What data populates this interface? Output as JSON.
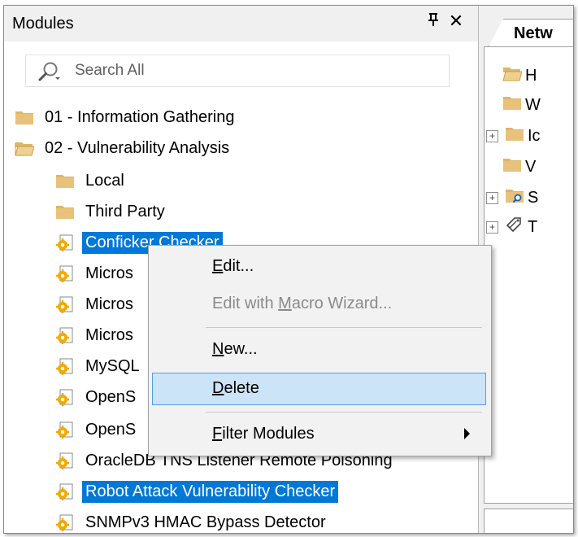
{
  "panel": {
    "title": "Modules",
    "pin_glyph": "`a",
    "close_glyph": "✕",
    "search_placeholder": "Search All"
  },
  "tree": {
    "items": [
      {
        "label": "01 - Information Gathering",
        "icon": "folder-icon"
      },
      {
        "label": "02 - Vulnerability Analysis",
        "icon": "folder-open-icon"
      },
      {
        "label": "Local",
        "icon": "folder-icon"
      },
      {
        "label": "Third Party",
        "icon": "folder-icon"
      },
      {
        "label": "Conficker Checker",
        "icon": "module-gear-icon",
        "selected": true
      },
      {
        "label": "Micros",
        "icon": "module-gear-icon"
      },
      {
        "label": "Micros",
        "icon": "module-gear-icon"
      },
      {
        "label": "Micros",
        "icon": "module-gear-icon"
      },
      {
        "label": "MySQL",
        "icon": "module-gear-icon"
      },
      {
        "label": "OpenS",
        "icon": "module-gear-icon"
      },
      {
        "label": "OpenS",
        "icon": "module-gear-icon"
      },
      {
        "label": "OracleDB TNS Listener Remote Poisoning",
        "icon": "module-gear-icon"
      },
      {
        "label": "Robot Attack Vulnerability Checker",
        "icon": "module-gear-icon",
        "selected": true
      },
      {
        "label": "SNMPv3 HMAC Bypass Detector",
        "icon": "module-gear-icon"
      }
    ]
  },
  "right_pane": {
    "tab_label": "Netw",
    "rows": [
      "H",
      "W",
      "Ic",
      "V",
      "S",
      "T"
    ]
  },
  "context_menu": {
    "edit_pre": "",
    "edit_u": "E",
    "edit_post": "dit...",
    "macro_pre": "Edit with ",
    "macro_u": "M",
    "macro_post": "acro Wizard...",
    "new_pre": "",
    "new_u": "N",
    "new_post": "ew...",
    "delete_pre": "",
    "delete_u": "D",
    "delete_post": "elete",
    "filter_pre": "",
    "filter_u": "F",
    "filter_post": "ilter Modules"
  },
  "colors": {
    "selection": "#0078d7",
    "menu_highlight": "#cce4f7",
    "menu_highlight_border": "#569de5",
    "folder": "#dcb66b"
  }
}
